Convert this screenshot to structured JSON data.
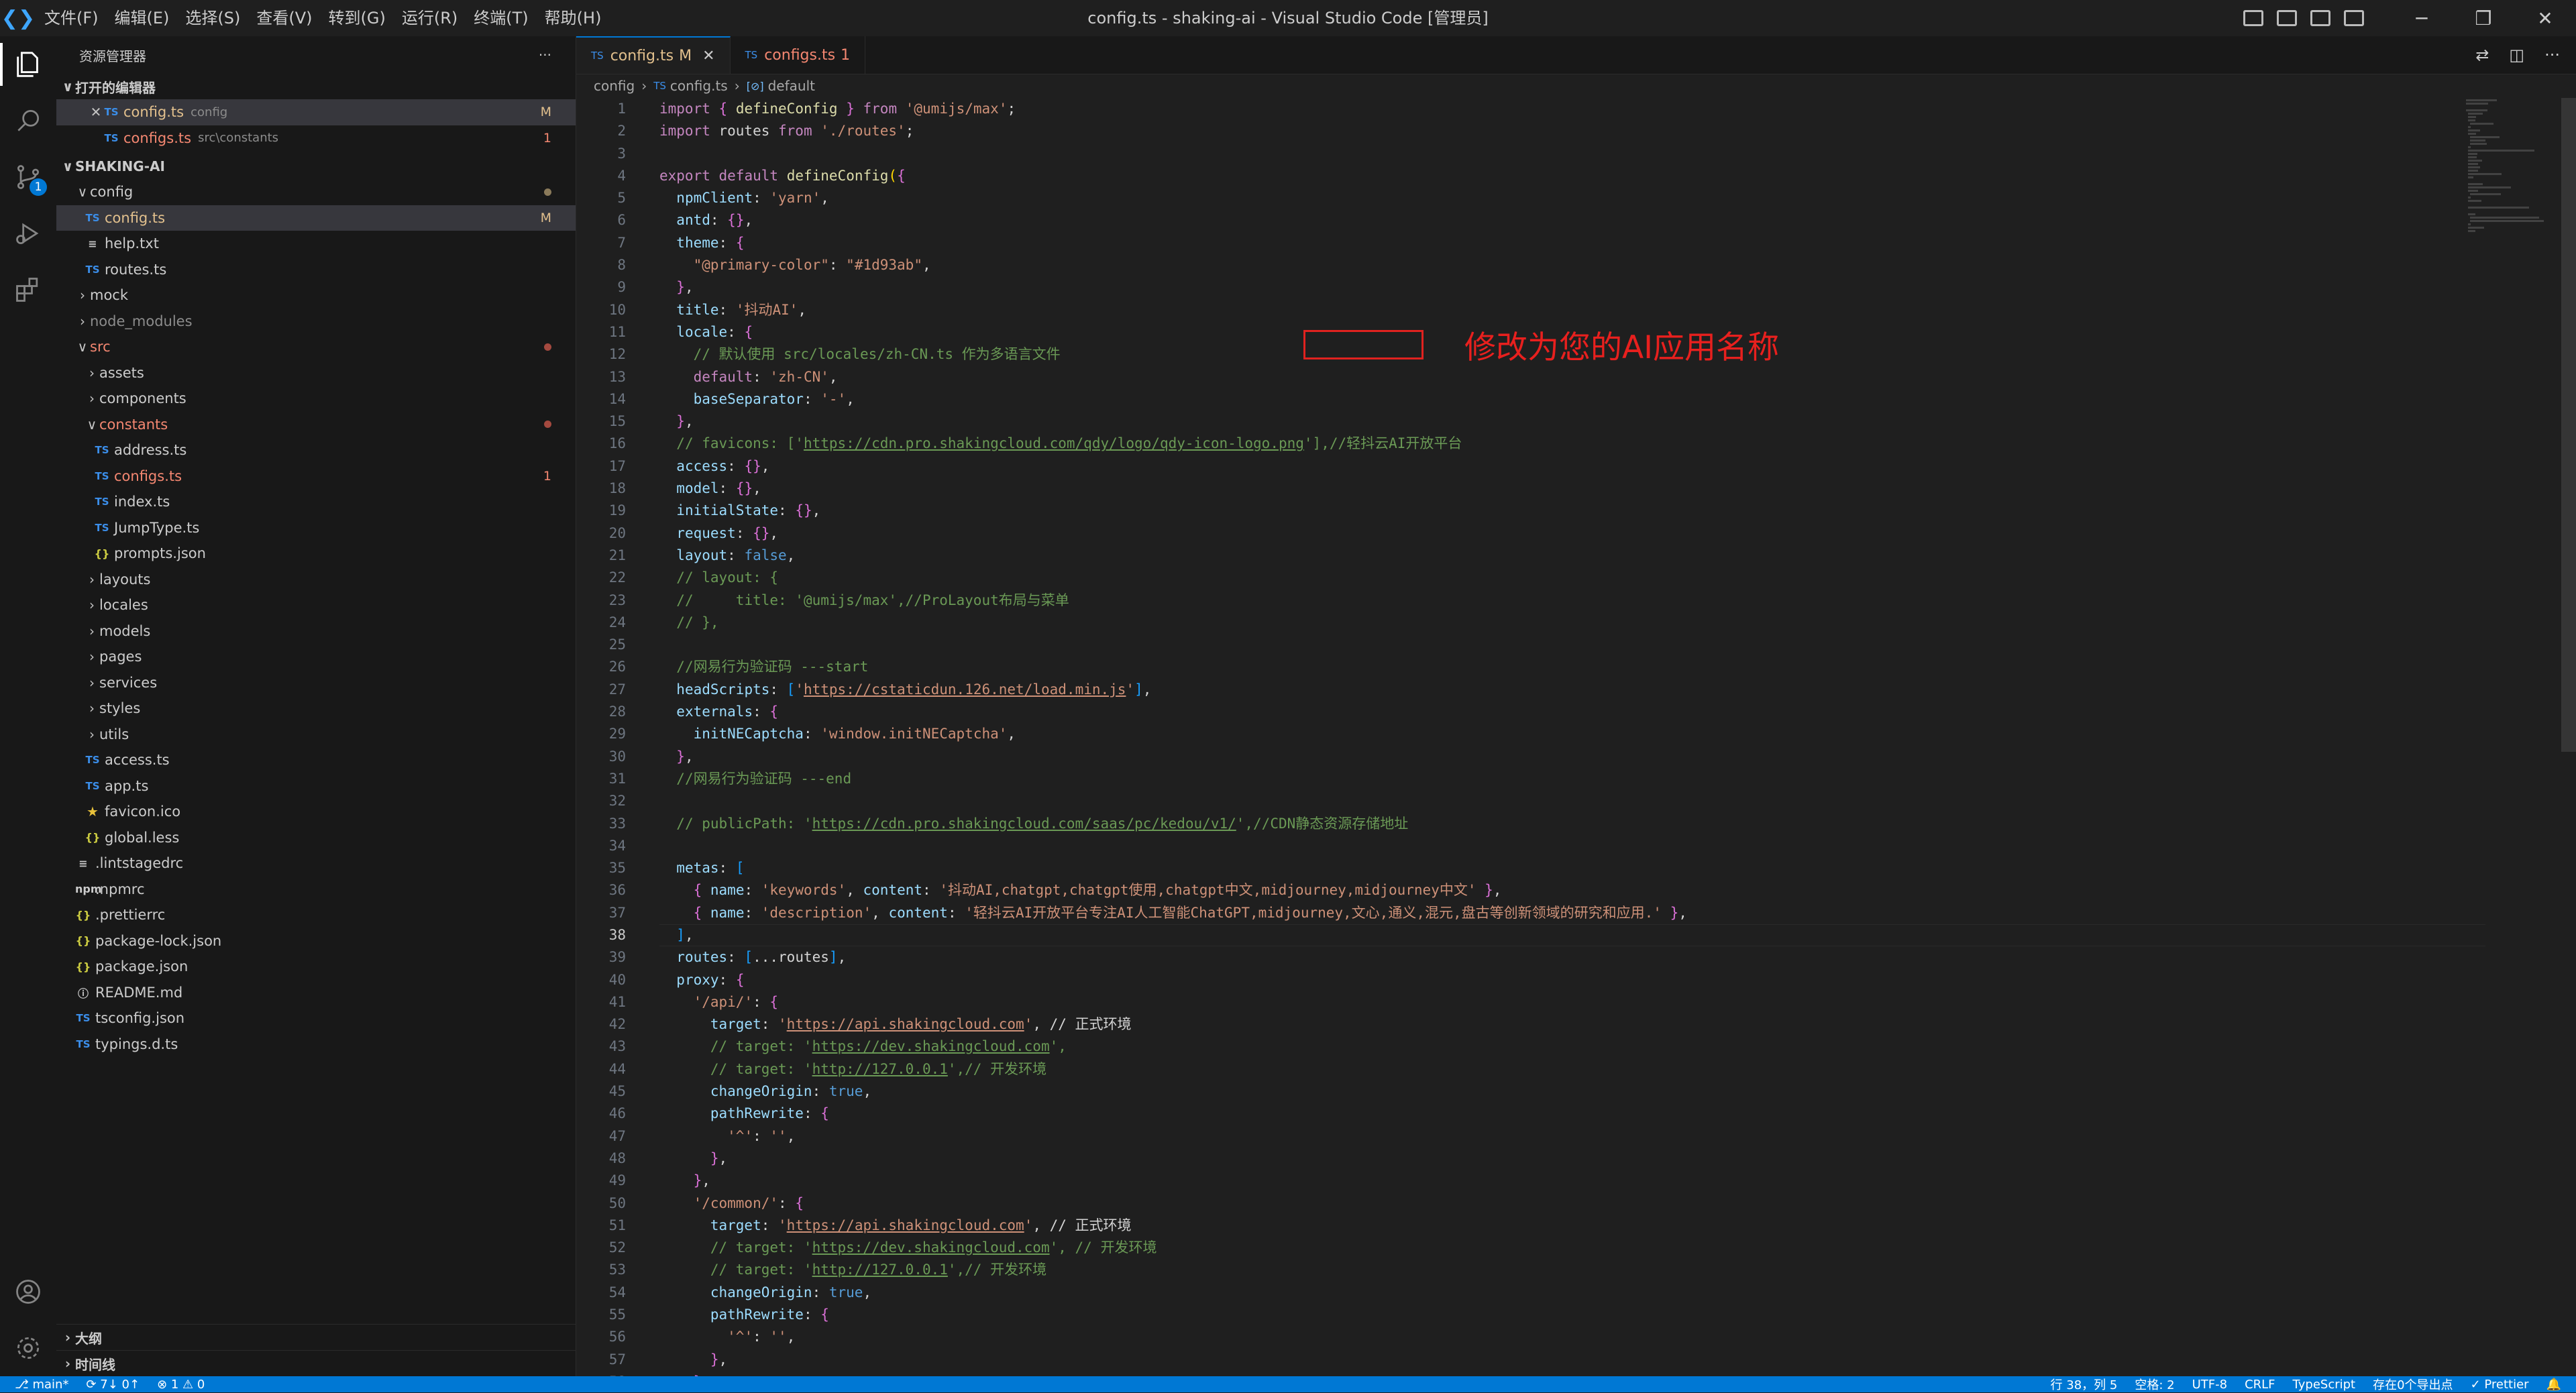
{
  "titlebar": {
    "menu": [
      "文件(F)",
      "编辑(E)",
      "选择(S)",
      "查看(V)",
      "转到(G)",
      "运行(R)",
      "终端(T)",
      "帮助(H)"
    ],
    "window_title": "config.ts - shaking-ai - Visual Studio Code [管理员]"
  },
  "activitybar": {
    "items": [
      "files-icon",
      "search-icon",
      "source-control-icon",
      "run-debug-icon",
      "extensions-icon"
    ],
    "scm_badge": "1"
  },
  "sidebar": {
    "title": "资源管理器",
    "more": "···",
    "open_editors_label": "打开的编辑器",
    "open_editors": [
      {
        "close": "✕",
        "icon": "TS",
        "name": "config.ts",
        "desc": "config",
        "badge": "M"
      },
      {
        "icon": "TS",
        "name": "configs.ts",
        "desc": "src\\constants",
        "badge": "1"
      }
    ],
    "project_label": "SHAKING-AI",
    "tree": [
      {
        "chev": "∨",
        "name": "config"
      },
      {
        "icon": "TS",
        "name": "config.ts",
        "badge": "M"
      },
      {
        "icon": "≡",
        "name": "help.txt"
      },
      {
        "icon": "TS",
        "name": "routes.ts"
      },
      {
        "chev": "›",
        "name": "mock"
      },
      {
        "chev": "›",
        "name": "node_modules"
      },
      {
        "chev": "∨",
        "name": "src"
      },
      {
        "chev": "›",
        "name": "assets"
      },
      {
        "chev": "›",
        "name": "components"
      },
      {
        "chev": "∨",
        "name": "constants"
      },
      {
        "icon": "TS",
        "name": "address.ts"
      },
      {
        "icon": "TS",
        "name": "configs.ts",
        "badge": "1"
      },
      {
        "icon": "TS",
        "name": "index.ts"
      },
      {
        "icon": "TS",
        "name": "JumpType.ts"
      },
      {
        "icon": "{}",
        "name": "prompts.json"
      },
      {
        "chev": "›",
        "name": "layouts"
      },
      {
        "chev": "›",
        "name": "locales"
      },
      {
        "chev": "›",
        "name": "models"
      },
      {
        "chev": "›",
        "name": "pages"
      },
      {
        "chev": "›",
        "name": "services"
      },
      {
        "chev": "›",
        "name": "styles"
      },
      {
        "chev": "›",
        "name": "utils"
      },
      {
        "icon": "TS",
        "name": "access.ts"
      },
      {
        "icon": "TS",
        "name": "app.ts"
      },
      {
        "icon": "★",
        "name": "favicon.ico"
      },
      {
        "icon": "{}",
        "name": "global.less"
      },
      {
        "icon": "≡",
        "name": ".lintstagedrc"
      },
      {
        "icon": "npm",
        "name": ".npmrc"
      },
      {
        "icon": "{}",
        "name": ".prettierrc"
      },
      {
        "icon": "{}",
        "name": "package-lock.json"
      },
      {
        "icon": "{}",
        "name": "package.json"
      },
      {
        "icon": "ⓘ",
        "name": "README.md"
      },
      {
        "icon": "TS",
        "name": "tsconfig.json"
      },
      {
        "icon": "TS",
        "name": "typings.d.ts"
      }
    ],
    "outline_label": "大纲",
    "timeline_label": "时间线"
  },
  "editor": {
    "tabs": [
      {
        "icon": "TS",
        "name": "config.ts",
        "badge": "M",
        "close": "✕"
      },
      {
        "icon": "TS",
        "name": "configs.ts",
        "badge": "1"
      }
    ],
    "breadcrumb": [
      "config",
      "config.ts",
      "default"
    ],
    "breadcrumb_icon": "TS",
    "breadcrumb_symbol_icon": "[⊘]",
    "current_line": 38,
    "lines": [
      "import { defineConfig } from '@umijs/max';",
      "import routes from './routes';",
      "",
      "export default defineConfig({",
      "  npmClient: 'yarn',",
      "  antd: {},",
      "  theme: {",
      "    \"@primary-color\": \"#1d93ab\",",
      "  },",
      "  title: '抖动AI',",
      "  locale: {",
      "    // 默认使用 src/locales/zh-CN.ts 作为多语言文件",
      "    default: 'zh-CN',",
      "    baseSeparator: '-',",
      "  },",
      "  // favicons: ['https://cdn.pro.shakingcloud.com/qdy/logo/qdy-icon-logo.png'],//轻抖云AI开放平台",
      "  access: {},",
      "  model: {},",
      "  initialState: {},",
      "  request: {},",
      "  layout: false,",
      "  // layout: {",
      "  //     title: '@umijs/max',//ProLayout布局与菜单",
      "  // },",
      "",
      "  //网易行为验证码 ---start",
      "  headScripts: ['https://cstaticdun.126.net/load.min.js'],",
      "  externals: {",
      "    initNECaptcha: 'window.initNECaptcha',",
      "  },",
      "  //网易行为验证码 ---end",
      "",
      "  // publicPath: 'https://cdn.pro.shakingcloud.com/saas/pc/kedou/v1/',//CDN静态资源存储地址",
      "",
      "  metas: [",
      "    { name: 'keywords', content: '抖动AI,chatgpt,chatgpt使用,chatgpt中文,midjourney,midjourney中文' },",
      "    { name: 'description', content: '轻抖云AI开放平台专注AI人工智能ChatGPT,midjourney,文心,通义,混元,盘古等创新领域的研究和应用.' },",
      "  ],",
      "  routes: [...routes],",
      "  proxy: {",
      "    '/api/': {",
      "      target: 'https://api.shakingcloud.com', // 正式环境",
      "      // target: 'https://dev.shakingcloud.com',",
      "      // target: 'http://127.0.0.1',// 开发环境",
      "      changeOrigin: true,",
      "      pathRewrite: {",
      "        '^': '',",
      "      },",
      "    },",
      "    '/common/': {",
      "      target: 'https://api.shakingcloud.com', // 正式环境",
      "      // target: 'https://dev.shakingcloud.com', // 开发环境",
      "      // target: 'http://127.0.0.1',// 开发环境",
      "      changeOrigin: true,",
      "      pathRewrite: {",
      "        '^': '',",
      "      },",
      "    },"
    ],
    "annotation": "修改为您的AI应用名称"
  },
  "statusbar": {
    "branch": "main*",
    "sync": "7↓ 0↑",
    "problems": "⊗ 1 ⚠ 0",
    "position": "行 38，列 5",
    "spaces": "空格: 2",
    "encoding": "UTF-8",
    "eol": "CRLF",
    "language": "TypeScript",
    "extra": "存在0个导出点",
    "prettier": "✓ Prettier"
  },
  "colors": {
    "accent": "#0078d4",
    "annotation_red": "#e0221f",
    "modified": "#e2c08d",
    "error": "#f48771"
  }
}
